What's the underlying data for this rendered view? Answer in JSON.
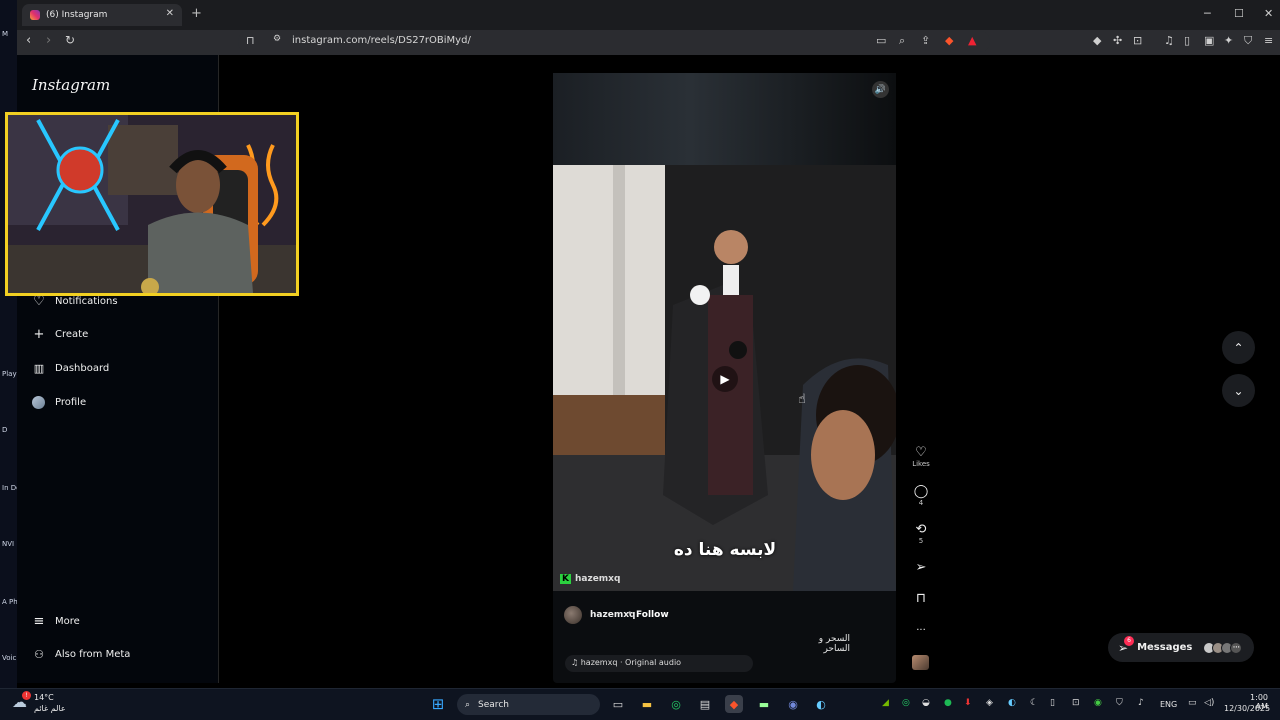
{
  "browser": {
    "tab_title": "(6) Instagram",
    "url": "instagram.com/reels/DS27rOBiMyd/",
    "new_tab": "+",
    "close_tab": "✕",
    "window": {
      "minimize": "─",
      "maximize": "☐",
      "close": "✕"
    }
  },
  "desktop_left": [
    {
      "label": "M"
    },
    {
      "label": "Play Acc"
    },
    {
      "label": "D"
    },
    {
      "label": "In Do"
    },
    {
      "label": "NVI"
    },
    {
      "label": "A Ph"
    },
    {
      "label": "Voic"
    }
  ],
  "sidebar": {
    "logo": "Instagram",
    "items": [
      {
        "label": "Notifications",
        "icon": "heart-icon"
      },
      {
        "label": "Create",
        "icon": "plus-icon"
      },
      {
        "label": "Dashboard",
        "icon": "chart-icon"
      },
      {
        "label": "Profile",
        "icon": "avatar"
      },
      {
        "label": "More",
        "icon": "menu-icon"
      },
      {
        "label": "Also from Meta",
        "icon": "meta-icon"
      }
    ]
  },
  "reel": {
    "subtitle": "لابسه هنا ده",
    "watermark": "hazemxq",
    "author": "hazemxq",
    "separator": "•",
    "follow_label": "Follow",
    "caption": "السحر و الساحر",
    "audio": "♫ hazemxq · Original audio",
    "actions": [
      {
        "name": "like",
        "icon": "♡",
        "count": "Likes"
      },
      {
        "name": "comment",
        "icon": "◯",
        "count": "4"
      },
      {
        "name": "repost",
        "icon": "⟲",
        "count": "5"
      },
      {
        "name": "share",
        "icon": "➢",
        "count": ""
      },
      {
        "name": "save",
        "icon": "🔖",
        "count": ""
      },
      {
        "name": "more",
        "icon": "···",
        "count": ""
      }
    ]
  },
  "messages": {
    "label": "Messages",
    "badge": "6"
  },
  "taskbar": {
    "weather_temp": "14°C",
    "weather_loc": "عالم غائم",
    "search_label": "Search",
    "language": "ENG",
    "time": "1:00 AM",
    "date": "12/30/2025"
  },
  "colors": {
    "accent": "#f2d022",
    "background": "#000000",
    "sidebar": "#03060c"
  }
}
